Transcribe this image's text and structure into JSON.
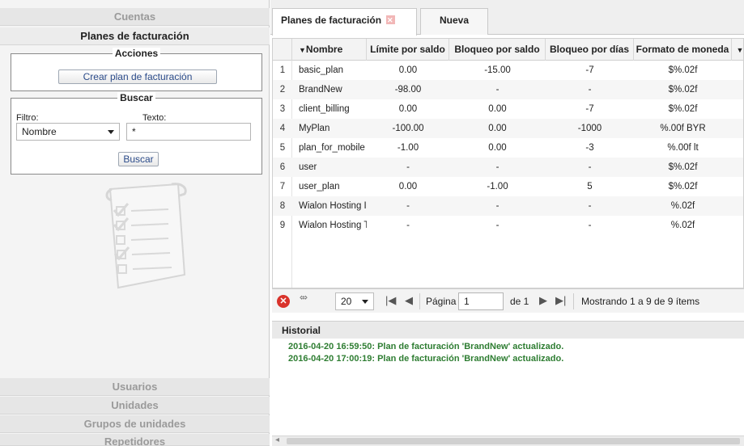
{
  "sidebar": {
    "sections": [
      "Cuentas",
      "Planes de facturación"
    ],
    "bottom_sections": [
      "Usuarios",
      "Unidades",
      "Grupos de unidades",
      "Repetidores"
    ],
    "actions": {
      "legend": "Acciones",
      "create_button": "Crear plan de facturación"
    },
    "search": {
      "legend": "Buscar",
      "filter_label": "Filtro:",
      "filter_value": "Nombre",
      "text_label": "Texto:",
      "text_value": "*",
      "search_button": "Buscar"
    }
  },
  "tabs": [
    "Planes de facturación",
    "Nueva"
  ],
  "table": {
    "columns": [
      "Nombre",
      "Límite por saldo",
      "Bloqueo por saldo",
      "Bloqueo por días",
      "Formato de moneda"
    ],
    "rows": [
      {
        "n": "1",
        "name": "basic_plan",
        "limit": "0.00",
        "block_balance": "-15.00",
        "block_days": "-7",
        "currency": "$%.02f"
      },
      {
        "n": "2",
        "name": "BrandNew",
        "limit": "-98.00",
        "block_balance": "-",
        "block_days": "-",
        "currency": "$%.02f"
      },
      {
        "n": "3",
        "name": "client_billing",
        "limit": "0.00",
        "block_balance": "0.00",
        "block_days": "-7",
        "currency": "$%.02f"
      },
      {
        "n": "4",
        "name": "MyPlan",
        "limit": "-100.00",
        "block_balance": "0.00",
        "block_days": "-1000",
        "currency": "%.00f BYR"
      },
      {
        "n": "5",
        "name": "plan_for_mobile",
        "limit": "-1.00",
        "block_balance": "0.00",
        "block_days": "-3",
        "currency": "%.00f lt"
      },
      {
        "n": "6",
        "name": "user",
        "limit": "-",
        "block_balance": "-",
        "block_days": "-",
        "currency": "$%.02f"
      },
      {
        "n": "7",
        "name": "user_plan",
        "limit": "0.00",
        "block_balance": "-1.00",
        "block_days": "5",
        "currency": "$%.02f"
      },
      {
        "n": "8",
        "name": "Wialon Hosting I",
        "limit": "-",
        "block_balance": "-",
        "block_days": "-",
        "currency": "%.02f"
      },
      {
        "n": "9",
        "name": "Wialon Hosting T",
        "limit": "-",
        "block_balance": "-",
        "block_days": "-",
        "currency": "%.02f"
      }
    ]
  },
  "pager": {
    "page_size": "20",
    "page_label": "Página",
    "page_value": "1",
    "of_label": "de 1",
    "status": "Mostrando 1 a 9 de 9 ítems"
  },
  "history": {
    "title": "Historial",
    "entries": [
      "2016-04-20 16:59:50: Plan de facturación 'BrandNew' actualizado.",
      "2016-04-20 17:00:19: Plan de facturación 'BrandNew' actualizado."
    ]
  }
}
